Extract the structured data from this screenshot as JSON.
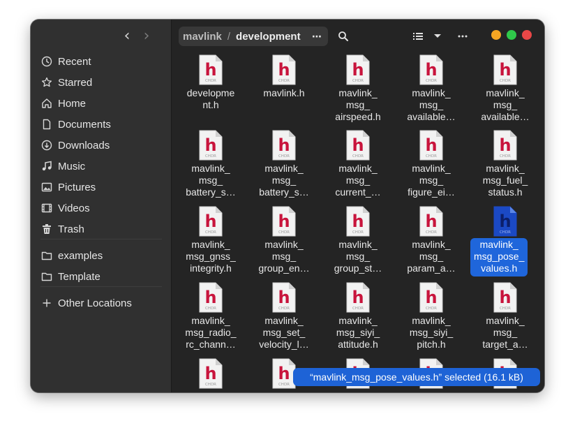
{
  "sidebar": {
    "items": [
      {
        "label": "Recent",
        "icon": "clock-icon"
      },
      {
        "label": "Starred",
        "icon": "star-icon"
      },
      {
        "label": "Home",
        "icon": "home-icon"
      },
      {
        "label": "Documents",
        "icon": "document-icon"
      },
      {
        "label": "Downloads",
        "icon": "download-icon"
      },
      {
        "label": "Music",
        "icon": "music-icon"
      },
      {
        "label": "Pictures",
        "icon": "pictures-icon"
      },
      {
        "label": "Videos",
        "icon": "videos-icon"
      },
      {
        "label": "Trash",
        "icon": "trash-icon"
      },
      {
        "label": "examples",
        "icon": "folder-icon"
      },
      {
        "label": "Template",
        "icon": "folder-icon"
      },
      {
        "label": "Other Locations",
        "icon": "plus-icon"
      }
    ]
  },
  "pathbar": {
    "parent": "mavlink",
    "separator": "/",
    "current": "development",
    "menu": "⋯"
  },
  "window_controls": {
    "minimize": "#f6a623",
    "maximize": "#2fc84a",
    "close": "#e94747"
  },
  "icon_label": "CHDR",
  "icon_letter": "h",
  "colors": {
    "accent": "#1f66db",
    "header_letter": "#c8143c"
  },
  "files": [
    {
      "lines": [
        "developme",
        "nt.h"
      ]
    },
    {
      "lines": [
        "mavlink.h"
      ]
    },
    {
      "lines": [
        "mavlink_",
        "msg_",
        "airspeed.h"
      ]
    },
    {
      "lines": [
        "mavlink_",
        "msg_",
        "available…"
      ]
    },
    {
      "lines": [
        "mavlink_",
        "msg_",
        "available…"
      ]
    },
    {
      "lines": [
        "mavlink_",
        "msg_",
        "battery_s…"
      ]
    },
    {
      "lines": [
        "mavlink_",
        "msg_",
        "battery_s…"
      ]
    },
    {
      "lines": [
        "mavlink_",
        "msg_",
        "current_…"
      ]
    },
    {
      "lines": [
        "mavlink_",
        "msg_",
        "figure_ei…"
      ]
    },
    {
      "lines": [
        "mavlink_",
        "msg_fuel_",
        "status.h"
      ]
    },
    {
      "lines": [
        "mavlink_",
        "msg_gnss_",
        "integrity.h"
      ]
    },
    {
      "lines": [
        "mavlink_",
        "msg_",
        "group_en…"
      ]
    },
    {
      "lines": [
        "mavlink_",
        "msg_",
        "group_st…"
      ]
    },
    {
      "lines": [
        "mavlink_",
        "msg_",
        "param_a…"
      ]
    },
    {
      "lines": [
        "mavlink_",
        "msg_pose_",
        "values.h"
      ],
      "selected": true
    },
    {
      "lines": [
        "mavlink_",
        "msg_radio_",
        "rc_chann…"
      ]
    },
    {
      "lines": [
        "mavlink_",
        "msg_set_",
        "velocity_l…"
      ]
    },
    {
      "lines": [
        "mavlink_",
        "msg_siyi_",
        "attitude.h"
      ]
    },
    {
      "lines": [
        "mavlink_",
        "msg_siyi_",
        "pitch.h"
      ]
    },
    {
      "lines": [
        "mavlink_",
        "msg_",
        "target_a…"
      ]
    },
    {
      "lines": []
    },
    {
      "lines": []
    },
    {
      "lines": []
    },
    {
      "lines": []
    },
    {
      "lines": []
    }
  ],
  "status": "“mavlink_msg_pose_values.h” selected  (16.1 kB)"
}
